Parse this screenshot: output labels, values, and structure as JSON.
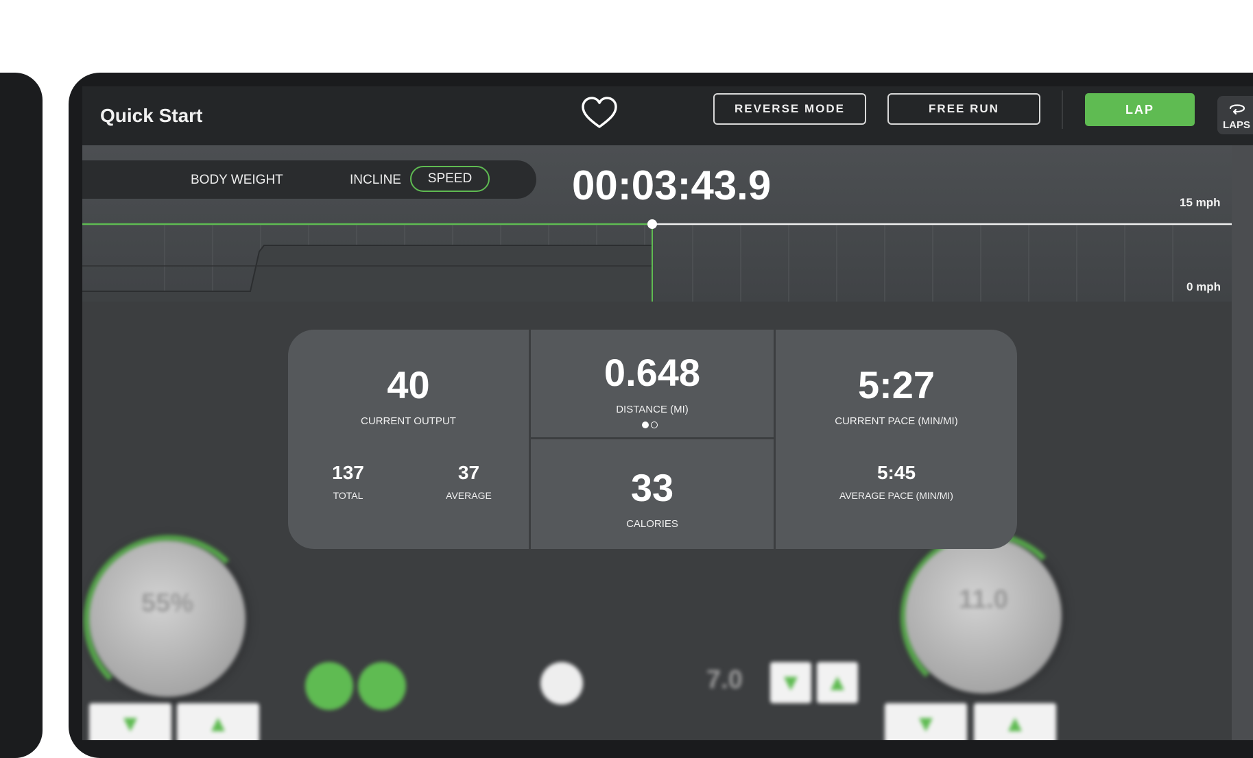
{
  "header": {
    "title": "Quick Start",
    "reverse_mode_label": "REVERSE MODE",
    "free_run_label": "FREE RUN",
    "lap_label": "LAP",
    "laps_label": "LAPS"
  },
  "graph": {
    "tabs": [
      "BODY WEIGHT",
      "INCLINE",
      "SPEED"
    ],
    "active_tab": "SPEED",
    "timer": "00:03:43.9",
    "scale_max": "15 mph",
    "scale_min": "0 mph"
  },
  "metrics": {
    "current_output_value": "40",
    "current_output_label": "CURRENT OUTPUT",
    "total_value": "137",
    "total_label": "TOTAL",
    "average_value": "37",
    "average_label": "AVERAGE",
    "distance_value": "0.648",
    "distance_label": "DISTANCE (MI)",
    "calories_value": "33",
    "calories_label": "CALORIES",
    "current_pace_value": "5:27",
    "current_pace_label": "CURRENT PACE (MIN/MI)",
    "average_pace_value": "5:45",
    "average_pace_label": "AVERAGE PACE (MIN/MI)"
  },
  "controls": {
    "left_knob_value": "55%",
    "right_knob_value": "11.0",
    "incline_value": "7.0"
  },
  "colors": {
    "accent": "#5fbb52",
    "header_bg": "#242628",
    "card_bg": "#55585b"
  }
}
